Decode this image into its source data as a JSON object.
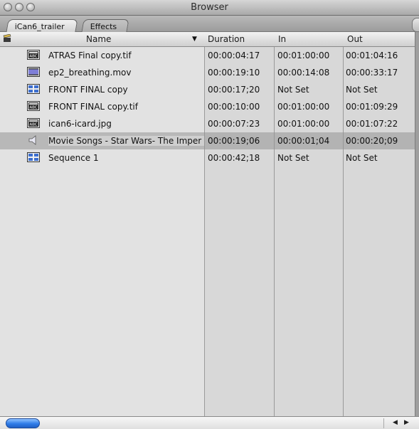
{
  "window": {
    "title": "Browser"
  },
  "tabs": [
    {
      "label": "iCan6_trailer",
      "active": true
    },
    {
      "label": "Effects",
      "active": false
    }
  ],
  "columns": {
    "name": "Name",
    "duration": "Duration",
    "in": "In",
    "out": "Out"
  },
  "rows": [
    {
      "icon": "still-image-icon",
      "name": "ATRAS Final copy.tif",
      "duration": "00:00:04:17",
      "in": "00:01:00:00",
      "out": "00:01:04:16"
    },
    {
      "icon": "movie-clip-icon",
      "name": "ep2_breathing.mov",
      "duration": "00:00:19:10",
      "in": "00:00:14:08",
      "out": "00:00:33:17"
    },
    {
      "icon": "sequence-icon",
      "name": "FRONT FINAL copy",
      "duration": "00:00:17;20",
      "in": "Not Set",
      "out": "Not Set"
    },
    {
      "icon": "still-image-icon",
      "name": "FRONT FINAL copy.tif",
      "duration": "00:00:10:00",
      "in": "00:01:00:00",
      "out": "00:01:09:29"
    },
    {
      "icon": "still-image-icon",
      "name": "ican6-icard.jpg",
      "duration": "00:00:07:23",
      "in": "00:01:00:00",
      "out": "00:01:07:22"
    },
    {
      "icon": "audio-speaker-icon",
      "name": "Movie Songs - Star Wars- The Imper",
      "duration": "00:00:19;06",
      "in": "00:00:01;04",
      "out": "00:00:20;09",
      "selected": true
    },
    {
      "icon": "sequence-icon",
      "name": "Sequence 1",
      "duration": "00:00:42;18",
      "in": "Not Set",
      "out": "Not Set"
    }
  ]
}
